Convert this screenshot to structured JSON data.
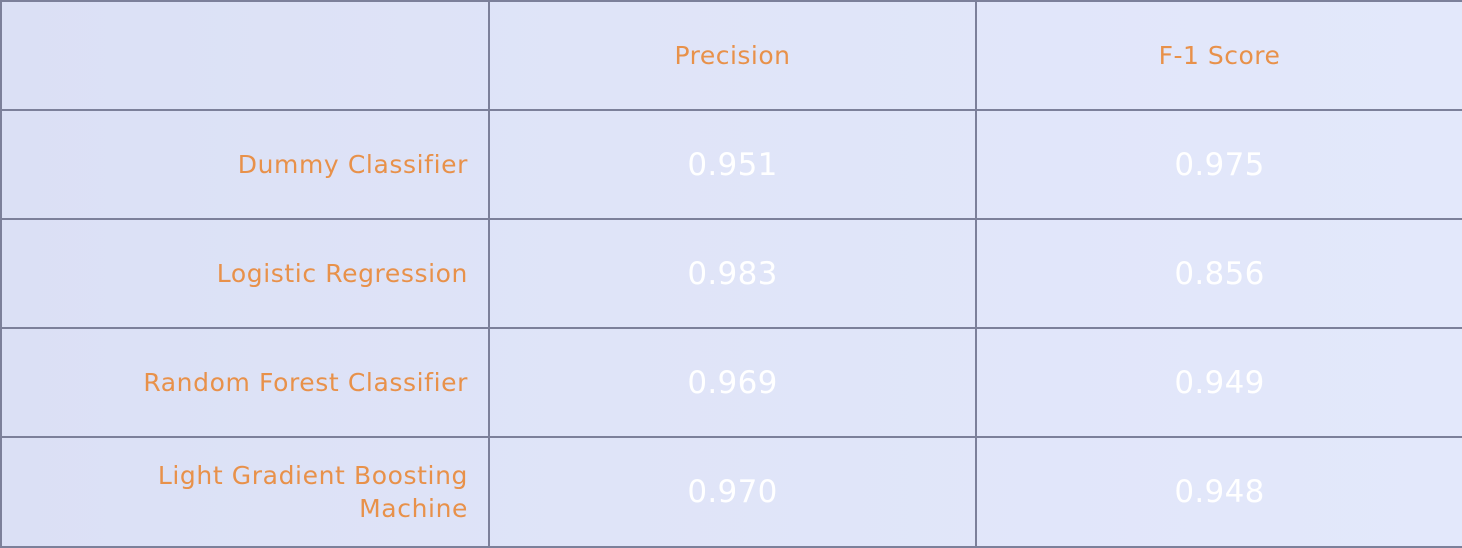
{
  "chart_data": {
    "type": "table",
    "columns": [
      "",
      "Precision",
      "F-1 Score"
    ],
    "rows": [
      {
        "label": "Dummy Classifier",
        "values": [
          "0.951",
          "0.975"
        ]
      },
      {
        "label": "Logistic Regression",
        "values": [
          "0.983",
          "0.856"
        ]
      },
      {
        "label": "Random Forest Classifier",
        "values": [
          "0.969",
          "0.949"
        ]
      },
      {
        "label": "Light Gradient Boosting Machine",
        "values": [
          "0.970",
          "0.948"
        ]
      }
    ]
  },
  "colors": {
    "label_text": "#e8914a",
    "value_text": "#ffffff",
    "grid_line": "#7c809a",
    "background": "#dfe4f8"
  }
}
